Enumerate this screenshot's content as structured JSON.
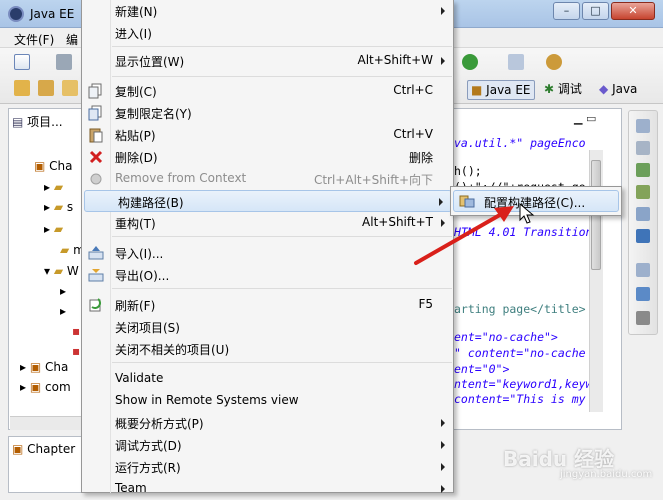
{
  "window": {
    "title": "Java EE"
  },
  "menubar": {
    "file": "文件(F)",
    "edit": "编"
  },
  "perspectives": [
    {
      "label": "Java EE",
      "active": true
    },
    {
      "label": "调试",
      "active": false
    },
    {
      "label": "Java",
      "active": false
    }
  ],
  "explorer": {
    "tab_label": "项目...",
    "rows": [
      "Cha",
      "s",
      "m",
      "W",
      "Cha",
      "com"
    ],
    "bottom_tab": "Chapter"
  },
  "editor": {
    "lines": [
      {
        "text": "va.util.*\" pageEnco",
        "cls": "c-str"
      },
      {
        "text": "h();",
        "cls": "c-plain"
      },
      {
        "text": "()+\"://\"+request.ge",
        "cls": "c-plain"
      },
      {
        "text": "HTML 4.01 Transition",
        "cls": "c-str"
      },
      {
        "text": "arting page</title>",
        "cls": "c-tag"
      },
      {
        "text": "ent=\"no-cache\">",
        "cls": "c-str"
      },
      {
        "text": "\" content=\"no-cache",
        "cls": "c-str"
      },
      {
        "text": "ent=\"0\">",
        "cls": "c-str"
      },
      {
        "text": "ntent=\"keyword1,keyw",
        "cls": "c-str"
      },
      {
        "text": "content=\"This is my",
        "cls": "c-str"
      }
    ]
  },
  "context_menu": {
    "items": [
      {
        "label": "新建(N)",
        "shortcut": "",
        "submenu": true,
        "icon": ""
      },
      {
        "label": "进入(I)",
        "shortcut": "",
        "submenu": false,
        "icon": ""
      },
      {
        "label": "显示位置(W)",
        "shortcut": "Alt+Shift+W",
        "submenu": true,
        "icon": ""
      },
      {
        "label": "复制(C)",
        "shortcut": "Ctrl+C",
        "submenu": false,
        "icon": "copy-icon"
      },
      {
        "label": "复制限定名(Y)",
        "shortcut": "",
        "submenu": false,
        "icon": "copy-qualified-icon"
      },
      {
        "label": "粘贴(P)",
        "shortcut": "Ctrl+V",
        "submenu": false,
        "icon": "paste-icon"
      },
      {
        "label": "删除(D)",
        "shortcut": "删除",
        "submenu": false,
        "icon": "delete-icon"
      },
      {
        "label": "Remove from Context",
        "shortcut": "Ctrl+Alt+Shift+向下",
        "submenu": false,
        "icon": "remove-context-icon",
        "disabled": true
      },
      {
        "label": "构建路径(B)",
        "shortcut": "",
        "submenu": true,
        "icon": "",
        "highlighted": true
      },
      {
        "label": "重构(T)",
        "shortcut": "Alt+Shift+T",
        "submenu": true,
        "icon": ""
      },
      {
        "label": "导入(I)...",
        "shortcut": "",
        "submenu": false,
        "icon": "import-icon"
      },
      {
        "label": "导出(O)...",
        "shortcut": "",
        "submenu": false,
        "icon": "export-icon"
      },
      {
        "label": "刷新(F)",
        "shortcut": "F5",
        "submenu": false,
        "icon": "refresh-icon"
      },
      {
        "label": "关闭项目(S)",
        "shortcut": "",
        "submenu": false,
        "icon": ""
      },
      {
        "label": "关闭不相关的项目(U)",
        "shortcut": "",
        "submenu": false,
        "icon": ""
      },
      {
        "label": "Validate",
        "shortcut": "",
        "submenu": false,
        "icon": ""
      },
      {
        "label": "Show in Remote Systems view",
        "shortcut": "",
        "submenu": false,
        "icon": ""
      },
      {
        "label": "概要分析方式(P)",
        "shortcut": "",
        "submenu": true,
        "icon": ""
      },
      {
        "label": "调试方式(D)",
        "shortcut": "",
        "submenu": true,
        "icon": ""
      },
      {
        "label": "运行方式(R)",
        "shortcut": "",
        "submenu": true,
        "icon": ""
      },
      {
        "label": "Team",
        "shortcut": "",
        "submenu": true,
        "icon": ""
      }
    ]
  },
  "submenu": {
    "label": "配置构建路径(C)..."
  },
  "watermark": {
    "main": "Baidu 经验",
    "sub": "jingyan.baidu.com"
  }
}
